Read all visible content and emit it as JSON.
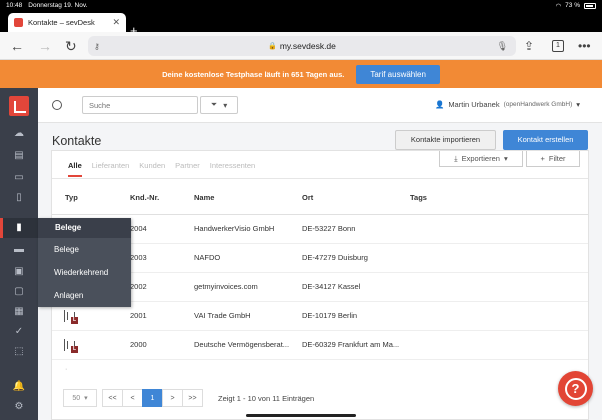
{
  "status_bar": {
    "time": "10:48",
    "date": "Donnerstag 19. Nov.",
    "battery": "73 %"
  },
  "browser": {
    "tab_title": "Kontakte – sevDesk",
    "new_tab": "+",
    "url": "my.sevdesk.de",
    "tab_count": "1"
  },
  "banner": {
    "text": "Deine kostenlose Testphase läuft in 651 Tagen aus.",
    "button": "Tarif auswählen"
  },
  "topbar": {
    "search_placeholder": "Suche",
    "user_name": "Martin Urbanek",
    "user_org": "(openHandwerk GmbH)"
  },
  "header": {
    "title": "Kontakte",
    "import_button": "Kontakte importieren",
    "create_button": "Kontakt erstellen"
  },
  "tabs": [
    "Alle",
    "Lieferanten",
    "Kunden",
    "Partner",
    "Interessenten"
  ],
  "toolbar": {
    "export": "Exportieren",
    "filter": "Filter"
  },
  "table": {
    "headers": {
      "typ": "Typ",
      "knd": "Knd.-Nr.",
      "name": "Name",
      "ort": "Ort",
      "tags": "Tags"
    },
    "rows": [
      {
        "knd": "2004",
        "name": "HandwerkerVisio GmbH",
        "ort": "DE-53227 Bonn"
      },
      {
        "knd": "2003",
        "name": "NAFDO",
        "ort": "DE-47279 Duisburg"
      },
      {
        "knd": "2002",
        "name": "getmyinvoices.com",
        "ort": "DE-34127 Kassel"
      },
      {
        "knd": "2001",
        "name": "VAI Trade GmbH",
        "ort": "DE-10179 Berlin"
      },
      {
        "knd": "2000",
        "name": "Deutsche Vermögensberat...",
        "ort": "DE-60329 Frankfurt am Ma..."
      }
    ],
    "row_badge": "L"
  },
  "flyout": {
    "title": "Belege",
    "items": [
      "Belege",
      "Wiederkehrend",
      "Anlagen"
    ]
  },
  "pagination": {
    "per_page": "50",
    "first": "<<",
    "prev": "<",
    "current": "1",
    "next": ">",
    "last": ">>",
    "info": "Zeigt 1 - 10 von 11 Einträgen"
  },
  "help": {
    "label": "?"
  },
  "colors": {
    "brand_red": "#e2463a",
    "banner_orange": "#f28a35",
    "primary_blue": "#3f86d6",
    "sidebar_dark": "#3a3f4a"
  }
}
